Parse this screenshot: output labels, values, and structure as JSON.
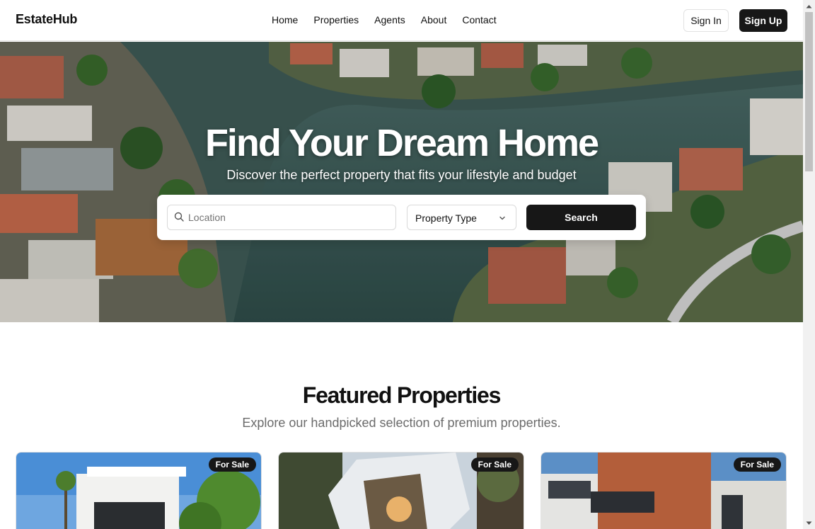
{
  "header": {
    "logo": "EstateHub",
    "nav": [
      "Home",
      "Properties",
      "Agents",
      "About",
      "Contact"
    ],
    "sign_in": "Sign In",
    "sign_up": "Sign Up"
  },
  "hero": {
    "title": "Find Your Dream Home",
    "subtitle": "Discover the perfect property that fits your lifestyle and budget",
    "search": {
      "location_placeholder": "Location",
      "location_value": "",
      "property_type": "Property Type",
      "button": "Search"
    }
  },
  "featured": {
    "title": "Featured Properties",
    "subtitle": "Explore our handpicked selection of premium properties.",
    "cards": [
      {
        "badge": "For Sale"
      },
      {
        "badge": "For Sale"
      },
      {
        "badge": "For Sale"
      }
    ]
  },
  "colors": {
    "primary": "#171717",
    "muted_text": "#6b6b6b",
    "border": "#e2e2e2"
  }
}
